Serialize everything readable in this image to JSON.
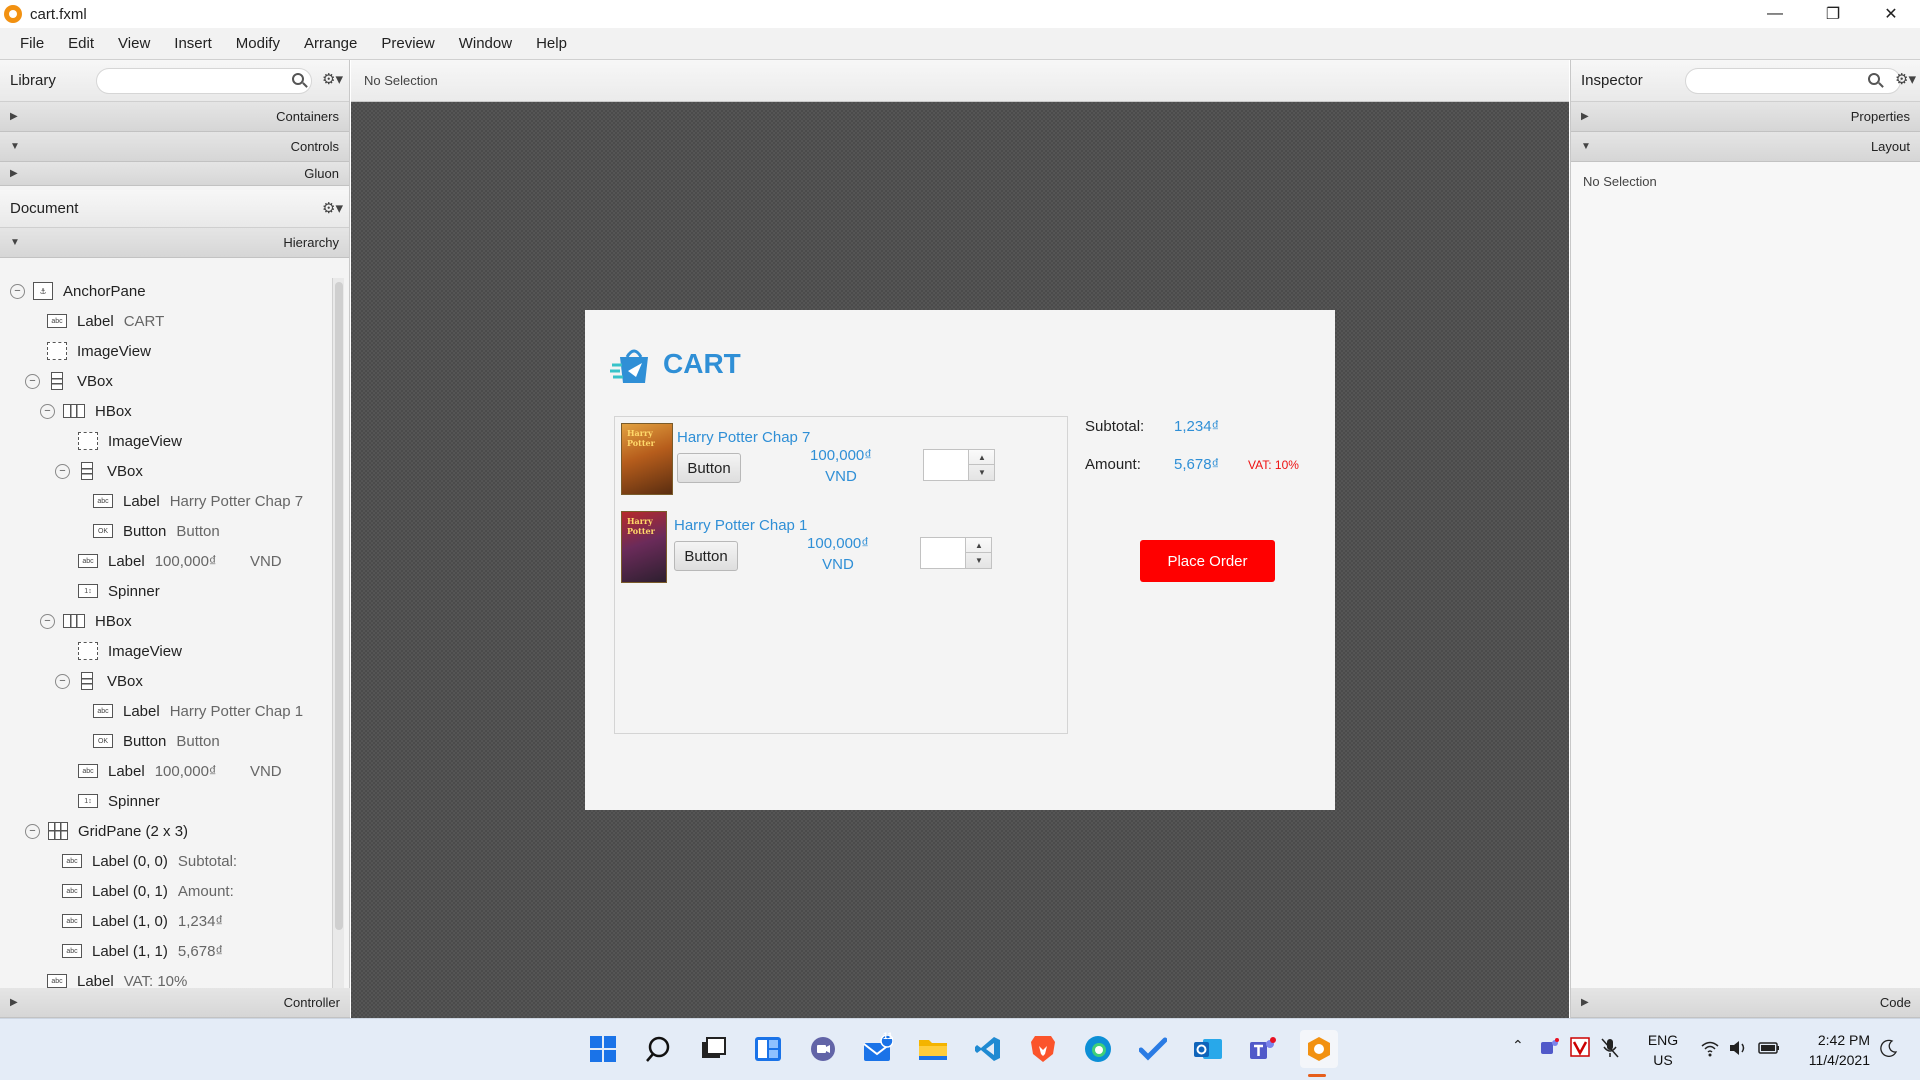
{
  "window": {
    "title": "cart.fxml"
  },
  "menu": [
    "File",
    "Edit",
    "View",
    "Insert",
    "Modify",
    "Arrange",
    "Preview",
    "Window",
    "Help"
  ],
  "library": {
    "title": "Library",
    "sections": [
      "Containers",
      "Controls",
      "Gluon"
    ]
  },
  "document": {
    "title": "Document",
    "hierarchy_label": "Hierarchy",
    "nodes": [
      {
        "type": "AnchorPane",
        "value": ""
      },
      {
        "type": "Label",
        "value": "CART"
      },
      {
        "type": "ImageView",
        "value": ""
      },
      {
        "type": "VBox",
        "value": ""
      },
      {
        "type": "HBox",
        "value": ""
      },
      {
        "type": "ImageView",
        "value": ""
      },
      {
        "type": "VBox",
        "value": ""
      },
      {
        "type": "Label",
        "value": "Harry Potter Chap 7"
      },
      {
        "type": "Button",
        "value": "Button"
      },
      {
        "type": "Label",
        "value": "100,000₫        VND"
      },
      {
        "type": "Spinner",
        "value": ""
      },
      {
        "type": "HBox",
        "value": ""
      },
      {
        "type": "ImageView",
        "value": ""
      },
      {
        "type": "VBox",
        "value": ""
      },
      {
        "type": "Label",
        "value": "Harry Potter Chap 1"
      },
      {
        "type": "Button",
        "value": "Button"
      },
      {
        "type": "Label",
        "value": "100,000₫        VND"
      },
      {
        "type": "Spinner",
        "value": ""
      },
      {
        "type": "GridPane (2 x 3)",
        "value": ""
      },
      {
        "type": "Label (0, 0)",
        "value": "Subtotal:"
      },
      {
        "type": "Label (0, 1)",
        "value": "Amount:"
      },
      {
        "type": "Label (1, 0)",
        "value": "1,234₫"
      },
      {
        "type": "Label (1, 1)",
        "value": "5,678₫"
      },
      {
        "type": "Label",
        "value": "VAT: 10%"
      }
    ],
    "controller_label": "Controller"
  },
  "center": {
    "selection": "No Selection"
  },
  "stage": {
    "title": "CART",
    "items": [
      {
        "cover_text": "Harry Potter",
        "name": "Harry Potter Chap 7",
        "button": "Button",
        "price": "100,000₫",
        "currency": "VND"
      },
      {
        "cover_text": "Harry Potter",
        "name": "Harry Potter Chap 1",
        "button": "Button",
        "price": "100,000₫",
        "currency": "VND"
      }
    ],
    "subtotal_label": "Subtotal:",
    "subtotal_value": "1,234₫",
    "amount_label": "Amount:",
    "amount_value": "5,678₫",
    "vat": "VAT: 10%",
    "place_order": "Place Order"
  },
  "inspector": {
    "title": "Inspector",
    "sections": [
      "Properties",
      "Layout"
    ],
    "selection": "No Selection",
    "code_label": "Code"
  },
  "taskbar": {
    "mail_badge": "11",
    "lang_line1": "ENG",
    "lang_line2": "US",
    "time": "2:42 PM",
    "date": "11/4/2021"
  },
  "colors": {
    "accent": "#2f8fd6",
    "place_order": "#ff0000",
    "vat": "#ee1111"
  }
}
